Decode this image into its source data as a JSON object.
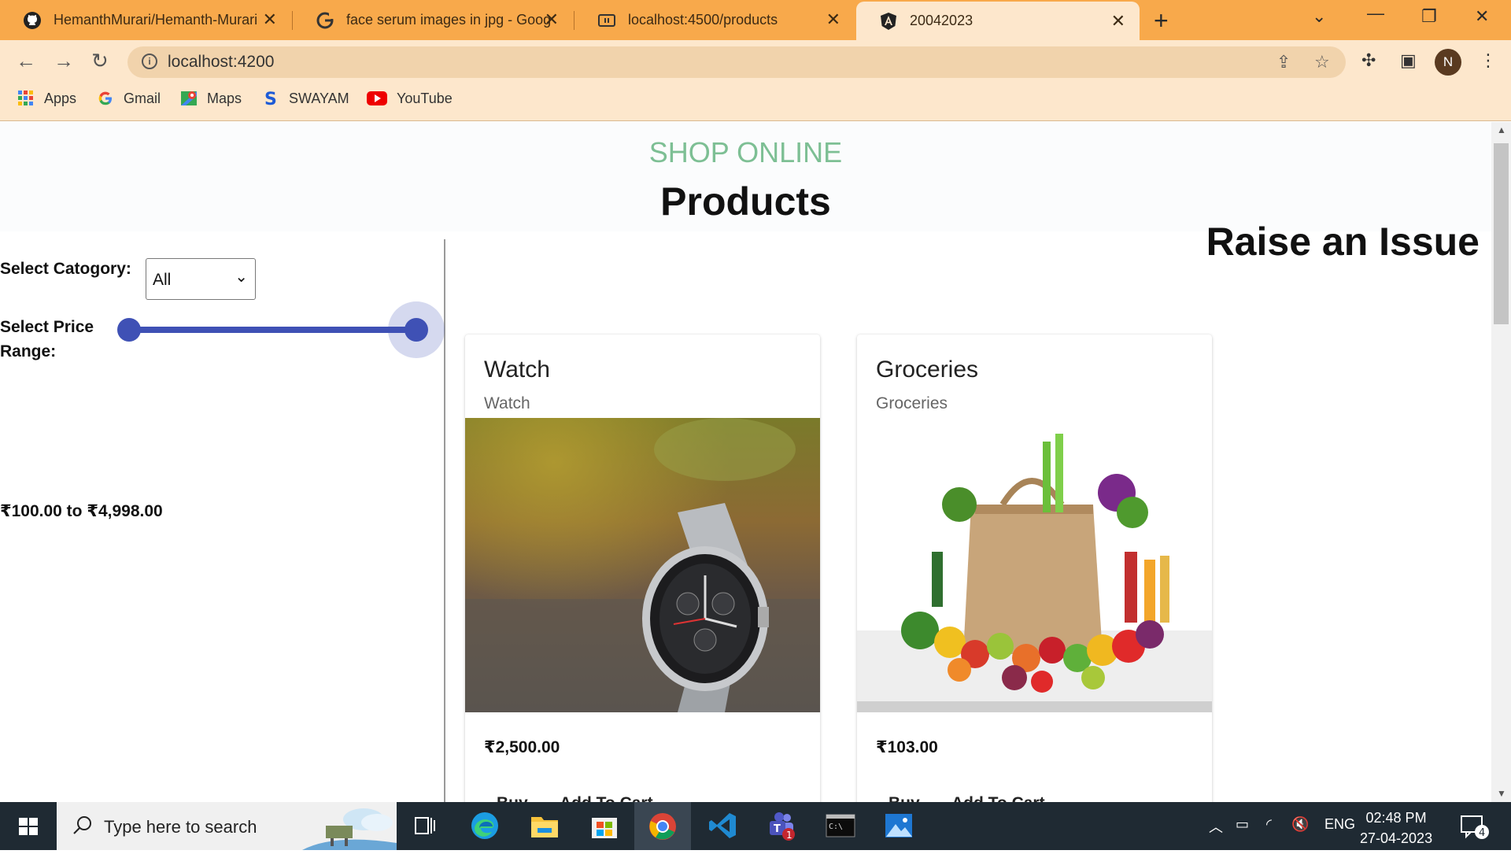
{
  "browser": {
    "tabs": [
      {
        "title": "HemanthMurari/Hemanth-Murari",
        "icon": "github-icon"
      },
      {
        "title": "face serum images in jpg - Google",
        "icon": "google-icon"
      },
      {
        "title": "localhost:4500/products",
        "icon": "page-icon"
      },
      {
        "title": "20042023",
        "icon": "angular-icon"
      }
    ],
    "address": "localhost:4200",
    "profile_initial": "N",
    "bookmarks": [
      {
        "label": "Apps"
      },
      {
        "label": "Gmail"
      },
      {
        "label": "Maps"
      },
      {
        "label": "SWAYAM"
      },
      {
        "label": "YouTube"
      }
    ]
  },
  "page": {
    "brand": "SHOP ONLINE",
    "heading": "Products",
    "raise_issue": "Raise an Issue",
    "filters": {
      "category_label": "Select Catogory:",
      "category_value": "All",
      "price_label_1": "Select Price",
      "price_label_2": "Range:",
      "price_range_text": "₹100.00 to ₹4,998.00",
      "slider_low_fraction": 0.0,
      "slider_high_fraction": 1.0
    },
    "products": [
      {
        "title": "Watch",
        "subtitle": "Watch",
        "price": "₹2,500.00",
        "buy": "Buy",
        "cart": "Add To Cart"
      },
      {
        "title": "Groceries",
        "subtitle": "Groceries",
        "price": "₹103.00",
        "buy": "Buy",
        "cart": "Add To Cart"
      }
    ]
  },
  "taskbar": {
    "search_placeholder": "Type here to search",
    "language": "ENG",
    "time": "02:48 PM",
    "date": "27-04-2023",
    "notification_count": "4",
    "teams_badge": "1"
  },
  "colors": {
    "tab_strip": "#f8a94b",
    "toolbar": "#fde7cc",
    "brand": "#7dbf94",
    "slider": "#3f51b5"
  }
}
